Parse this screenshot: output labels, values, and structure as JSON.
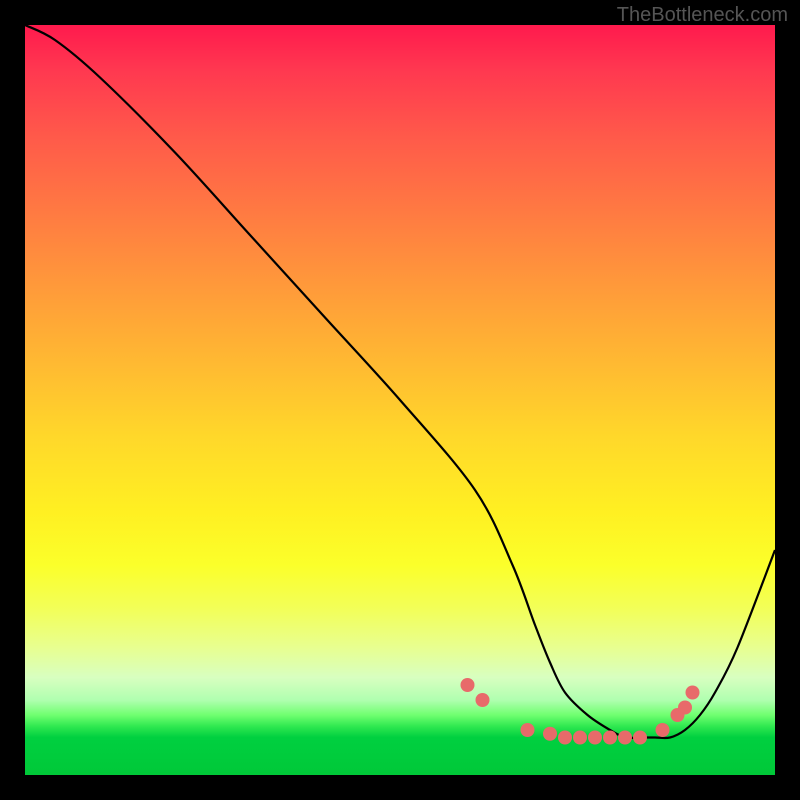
{
  "watermark": "TheBottleneck.com",
  "chart_data": {
    "type": "line",
    "title": "",
    "xlabel": "",
    "ylabel": "",
    "xlim": [
      0,
      100
    ],
    "ylim": [
      0,
      100
    ],
    "series": [
      {
        "name": "bottleneck-curve",
        "x": [
          0,
          4,
          10,
          20,
          30,
          40,
          50,
          60,
          65,
          68,
          70,
          72,
          75,
          78,
          80,
          82,
          84,
          86,
          88,
          90,
          92,
          95,
          100
        ],
        "y": [
          100,
          98,
          93,
          83,
          72,
          61,
          50,
          38,
          28,
          20,
          15,
          11,
          8,
          6,
          5,
          5,
          5,
          5,
          6,
          8,
          11,
          17,
          30
        ]
      }
    ],
    "markers": {
      "name": "highlight-points",
      "color": "#e86a6a",
      "x": [
        59,
        61,
        67,
        70,
        72,
        74,
        76,
        78,
        80,
        82,
        85,
        87,
        88,
        89
      ],
      "y": [
        12,
        10,
        6,
        5.5,
        5,
        5,
        5,
        5,
        5,
        5,
        6,
        8,
        9,
        11
      ]
    },
    "gradient_stops": [
      {
        "pos": 0,
        "color": "#ff1a4d"
      },
      {
        "pos": 50,
        "color": "#ffd82a"
      },
      {
        "pos": 93,
        "color": "#30e850"
      },
      {
        "pos": 100,
        "color": "#00c838"
      }
    ]
  }
}
